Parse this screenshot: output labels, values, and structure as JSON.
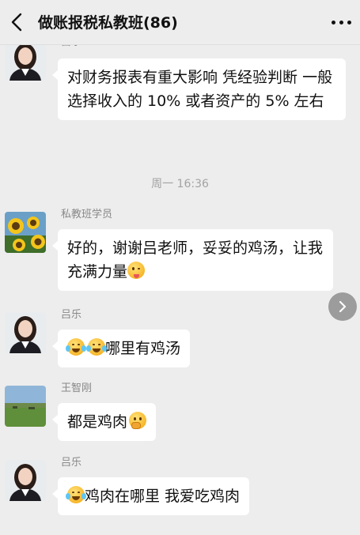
{
  "header": {
    "title": "做账报税私教班(86)"
  },
  "messages": [
    {
      "sender": "吕乐",
      "text": "对财务报表有重大影响  凭经验判断 一般选择收入的 10% 或者资产的 5% 左右"
    },
    {
      "sender": "私教班学员",
      "text": "好的，谢谢吕老师，妥妥的鸡汤，让我充满力量"
    },
    {
      "sender": "吕乐",
      "text": "哪里有鸡汤"
    },
    {
      "sender": "王智刚",
      "text": "都是鸡肉"
    },
    {
      "sender": "吕乐",
      "text": "鸡肉在哪里 我爱吃鸡肉"
    }
  ],
  "timestamp": "周一 16:36",
  "colors": {
    "background": "#ededed",
    "bubble": "#ffffff",
    "meta_text": "#888888"
  },
  "icons": [
    "back-icon",
    "more-icon",
    "chevron-right-icon",
    "laughing-tears-emoji",
    "tongue-out-emoji",
    "thinking-emoji"
  ]
}
